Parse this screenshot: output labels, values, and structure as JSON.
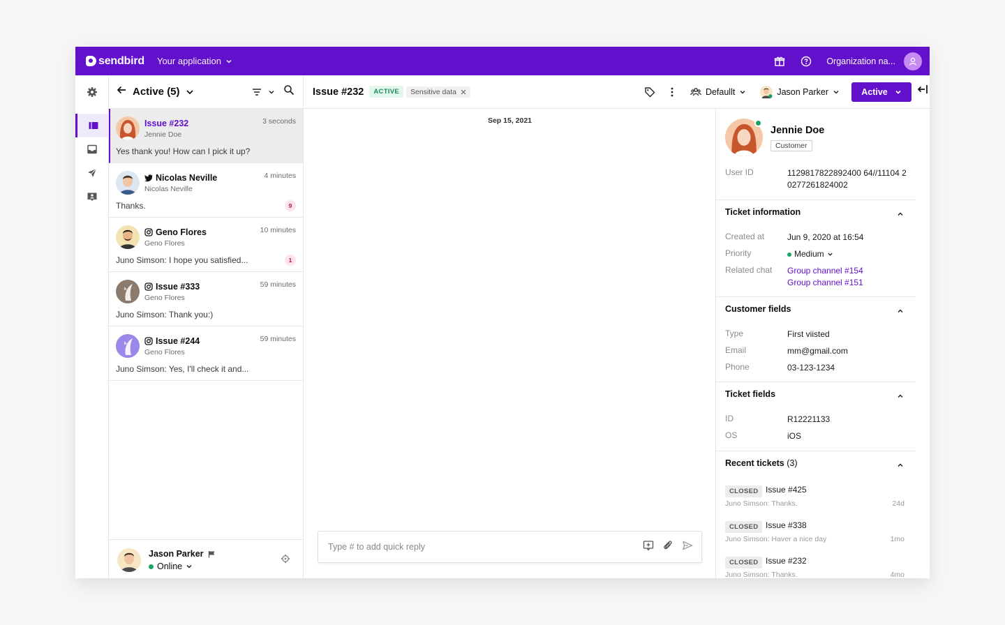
{
  "topbar": {
    "brand": "sendbird",
    "app_selector": "Your application",
    "org": "Organization na..."
  },
  "convlist": {
    "title": "Active (5)",
    "items": [
      {
        "name": "Issue #232",
        "channel": "",
        "sub": "Jennie Doe",
        "time": "3 seconds",
        "message": "Yes thank you! How can I pick it up?",
        "badge": ""
      },
      {
        "name": "Nicolas Neville",
        "channel": "twitter",
        "sub": "Nicolas Neville",
        "time": "4 minutes",
        "message": "Thanks.",
        "badge": "9"
      },
      {
        "name": "Geno Flores",
        "channel": "instagram",
        "sub": "Geno Flores",
        "time": "10 minutes",
        "message": "Juno Simson: I hope you satisfied...",
        "badge": "1"
      },
      {
        "name": "Issue #333",
        "channel": "instagram",
        "sub": "Geno Flores",
        "time": "59 minutes",
        "message": "Juno Simson: Thank you:)",
        "badge": ""
      },
      {
        "name": "Issue #244",
        "channel": "instagram",
        "sub": "Geno Flores",
        "time": "59 minutes",
        "message": "Juno Simson: Yes, I'll check it and...",
        "badge": ""
      }
    ],
    "agent": {
      "name": "Jason Parker",
      "status": "Online"
    }
  },
  "chat": {
    "ticket": "Issue #232",
    "status_tag": "ACTIVE",
    "sensitive_tag": "Sensitive data",
    "team": "Defaullt",
    "assignee": "Jason Parker",
    "action_button": "Active",
    "date_divider": "Sep 15, 2021",
    "composer_placeholder": "Type # to add quick reply"
  },
  "panel": {
    "name": "Jennie Doe",
    "role": "Customer",
    "user_id_label": "User ID",
    "user_id": "1129817822892400 64//11104 20277261824002",
    "ticket_info": {
      "header": "Ticket information",
      "created_label": "Created at",
      "created": "Jun 9, 2020 at 16:54",
      "priority_label": "Priority",
      "priority": "Medium",
      "related_label": "Related chat",
      "related": [
        "Group channel  #154",
        "Group channel  #151"
      ]
    },
    "customer_fields": {
      "header": "Customer fields",
      "type_label": "Type",
      "type": "First viisted",
      "email_label": "Email",
      "email": "mm@gmail.com",
      "phone_label": "Phone",
      "phone": "03-123-1234"
    },
    "ticket_fields": {
      "header": "Ticket fields",
      "id_label": "ID",
      "id": "R12221133",
      "os_label": "OS",
      "os": "iOS"
    },
    "recent": {
      "header": "Recent tickets",
      "count": "(3)",
      "items": [
        {
          "status": "CLOSED",
          "title": "Issue #425",
          "message": "Juno Simson: Thanks.",
          "age": "24d"
        },
        {
          "status": "CLOSED",
          "title": "Issue #338",
          "message": "Juno Simson: Haver a nice day",
          "age": "1mo"
        },
        {
          "status": "CLOSED",
          "title": "Issue #232",
          "message": "Juno Simson: Thanks.",
          "age": "4mo"
        }
      ]
    }
  },
  "colors": {
    "brand": "#6210cc",
    "online": "#1ca363",
    "active_tag_bg": "#e3f6ec"
  }
}
